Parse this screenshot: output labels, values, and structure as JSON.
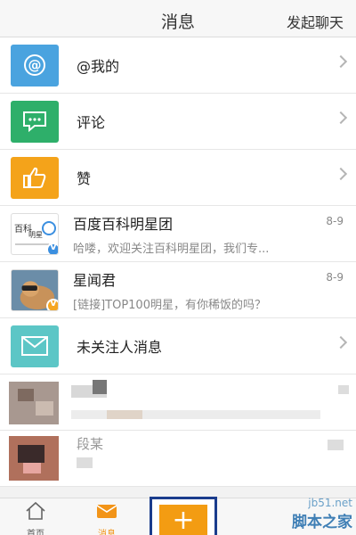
{
  "header": {
    "title": "消息",
    "action": "发起聊天"
  },
  "menu": [
    {
      "label": "@我的",
      "icon": "at-icon"
    },
    {
      "label": "评论",
      "icon": "comment-icon"
    },
    {
      "label": "赞",
      "icon": "thumbs-up-icon"
    }
  ],
  "conversations": [
    {
      "name": "百度百科明星团",
      "date": "8-9",
      "preview": "哈喽，欢迎关注百科明星团，我们专...",
      "badge": "V",
      "badge_color": "#3b8fe0"
    },
    {
      "name": "星闻君",
      "date": "8-9",
      "preview": "[链接]TOP100明星，有你稀饭的吗？",
      "badge": "V",
      "badge_color": "#f5a623"
    }
  ],
  "unfollowed": {
    "label": "未关注人消息",
    "icon": "mail-icon"
  },
  "blurred_row_2": {
    "name": "段某"
  },
  "tabbar": {
    "home": "首页",
    "messages": "消息",
    "plus": "+"
  },
  "watermark": {
    "site": "jb51.net",
    "name": "脚本之家"
  }
}
